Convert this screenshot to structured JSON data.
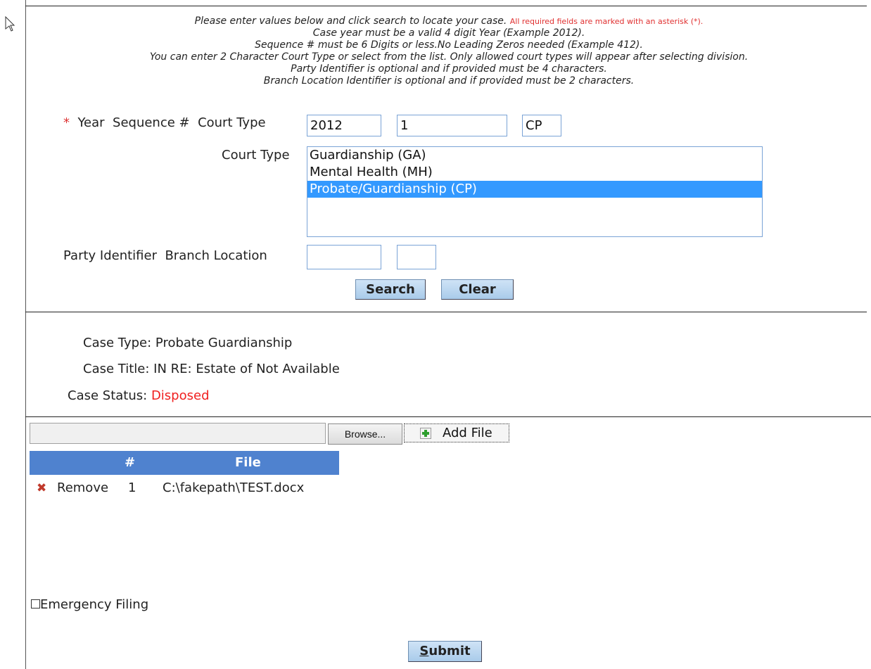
{
  "instructions": {
    "line1": "Please enter values below and click search to locate your case.",
    "required_note": "All required fields are marked with an asterisk (*).",
    "line2": "Case year must be a valid 4 digit Year (Example 2012).",
    "line3": "Sequence # must be 6 Digits or less.No Leading Zeros needed (Example 412).",
    "line4": "You can enter 2 Character Court Type or select from the list. Only allowed court types will appear after selecting division.",
    "line5": "Party Identifier is optional and if provided must be 4 characters.",
    "line6": "Branch Location Identifier is optional and if provided must be 2 characters."
  },
  "search_form": {
    "required_marker": "*",
    "labels": {
      "year": "Year",
      "sequence": "Sequence #",
      "court_type": "Court Type",
      "court_type_list": "Court Type",
      "party_identifier": "Party Identifier",
      "branch_location": "Branch Location"
    },
    "year_value": "2012",
    "sequence_value": "1",
    "court_type_value": "CP",
    "party_identifier_value": "",
    "branch_location_value": "",
    "court_type_options": [
      "Guardianship (GA)",
      "Mental Health (MH)",
      "Probate/Guardianship (CP)"
    ],
    "selected_option": "Probate/Guardianship (CP)",
    "search_label": "Search",
    "clear_label": "Clear"
  },
  "case_info": {
    "case_type_label": "Case Type:",
    "case_type_value": "Probate Guardianship",
    "case_title_label": "Case Title:",
    "case_title_value": "IN RE: Estate of Not Available",
    "case_status_label": "Case Status:",
    "case_status_value": "Disposed",
    "status_color": "#f02020"
  },
  "upload": {
    "file_path_value": "",
    "browse_label": "Browse...",
    "add_file_label": "Add File",
    "table_headers": {
      "number": "#",
      "file": "File"
    },
    "header_color": "#4f82cf",
    "rows": [
      {
        "action": "Remove",
        "number": "1",
        "file": "C:\\fakepath\\TEST.docx"
      }
    ]
  },
  "emergency_filing_label": "Emergency Filing",
  "emergency_filing_checked": false,
  "submit_label": "Submit"
}
